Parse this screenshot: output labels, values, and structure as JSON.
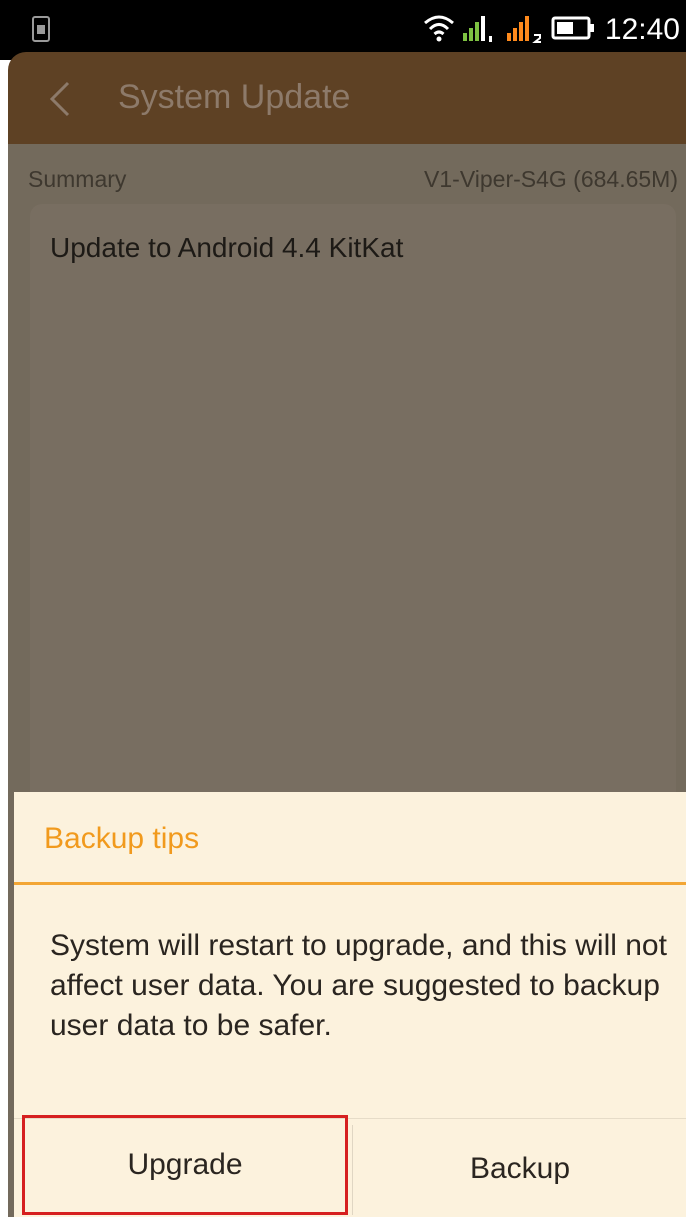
{
  "status_bar": {
    "time": "12:40"
  },
  "app_bar": {
    "title": "System Update"
  },
  "summary": {
    "label": "Summary",
    "version": "V1-Viper-S4G (684.65M)",
    "description": "Update to Android 4.4 KitKat"
  },
  "dialog": {
    "title": "Backup tips",
    "message": "System will restart to upgrade, and this will not affect user data. You are suggested to backup user data to be safer.",
    "buttons": {
      "upgrade": "Upgrade",
      "backup": "Backup"
    }
  },
  "colors": {
    "accent": "#f19a1d",
    "highlight": "#d62020",
    "app_bar": "#5e4124",
    "dialog_bg": "#fcf2dd"
  },
  "icons": [
    "sim-card-icon",
    "wifi-icon",
    "signal-1-icon",
    "signal-2-icon",
    "battery-icon",
    "back-arrow-icon"
  ]
}
